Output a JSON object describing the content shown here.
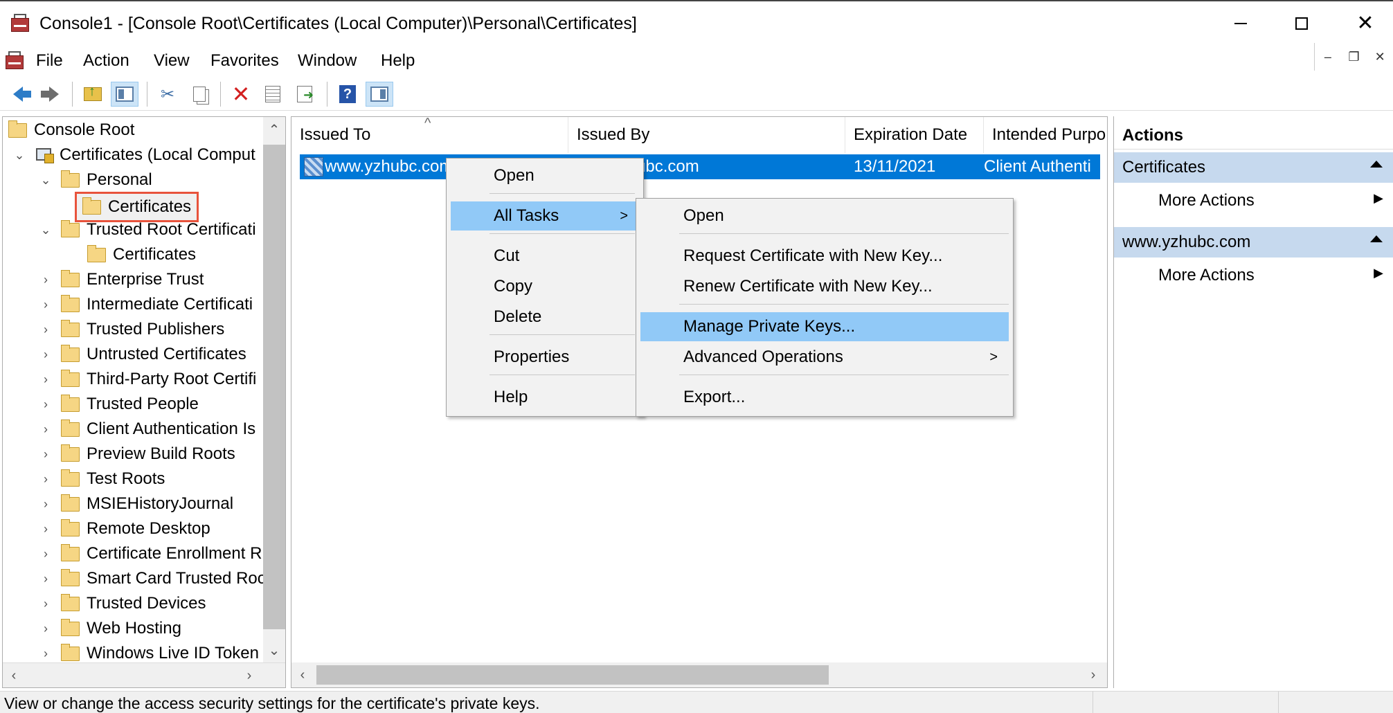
{
  "window": {
    "title": "Console1 - [Console Root\\Certificates (Local Computer)\\Personal\\Certificates]"
  },
  "menubar": {
    "items": [
      "File",
      "Action",
      "View",
      "Favorites",
      "Window",
      "Help"
    ]
  },
  "toolbar": {
    "icons": [
      "back-arrow-icon",
      "forward-arrow-icon",
      "up-one-level-icon",
      "show-hide-console-tree-icon",
      "cut-icon",
      "copy-icon",
      "delete-icon",
      "properties-icon",
      "export-list-icon",
      "help-icon",
      "show-hide-action-pane-icon"
    ]
  },
  "tree": {
    "items": [
      {
        "label": "Console Root"
      },
      {
        "label": "Certificates (Local Comput"
      },
      {
        "label": "Personal"
      },
      {
        "label": "Certificates"
      },
      {
        "label": "Trusted Root Certificati"
      },
      {
        "label": "Certificates"
      },
      {
        "label": "Enterprise Trust"
      },
      {
        "label": "Intermediate Certificati"
      },
      {
        "label": "Trusted Publishers"
      },
      {
        "label": "Untrusted Certificates"
      },
      {
        "label": "Third-Party Root Certifi"
      },
      {
        "label": "Trusted People"
      },
      {
        "label": "Client Authentication Is"
      },
      {
        "label": "Preview Build Roots"
      },
      {
        "label": "Test Roots"
      },
      {
        "label": "MSIEHistoryJournal"
      },
      {
        "label": "Remote Desktop"
      },
      {
        "label": "Certificate Enrollment R"
      },
      {
        "label": "Smart Card Trusted Roo"
      },
      {
        "label": "Trusted Devices"
      },
      {
        "label": "Web Hosting"
      },
      {
        "label": "Windows Live ID Token"
      }
    ]
  },
  "list": {
    "columns": [
      "Issued To",
      "Issued By",
      "Expiration Date",
      "Intended Purpo"
    ],
    "rows": [
      {
        "issued_to": "www.yzhubc.com",
        "issued_by": "ubc.com",
        "expiration": "13/11/2021",
        "purpose": "Client Authenti"
      }
    ]
  },
  "context_menu": {
    "items": [
      "Open",
      "All Tasks",
      "Cut",
      "Copy",
      "Delete",
      "Properties",
      "Help"
    ],
    "submenu_arrow": ">"
  },
  "submenu": {
    "items": [
      "Open",
      "Request Certificate with New Key...",
      "Renew Certificate with New Key...",
      "Manage Private Keys...",
      "Advanced Operations",
      "Export..."
    ],
    "submenu_arrow": ">"
  },
  "actions": {
    "title": "Actions",
    "sections": [
      {
        "name": "Certificates",
        "items": [
          "More Actions"
        ]
      },
      {
        "name": "www.yzhubc.com",
        "items": [
          "More Actions"
        ]
      }
    ]
  },
  "statusbar": {
    "text": "View or change the access security settings for the certificate's private keys."
  },
  "colors": {
    "selection": "#0078d7",
    "menu_highlight": "#91c9f7",
    "actions_section": "#c6d9ee",
    "selected_outline": "#e8533c"
  }
}
